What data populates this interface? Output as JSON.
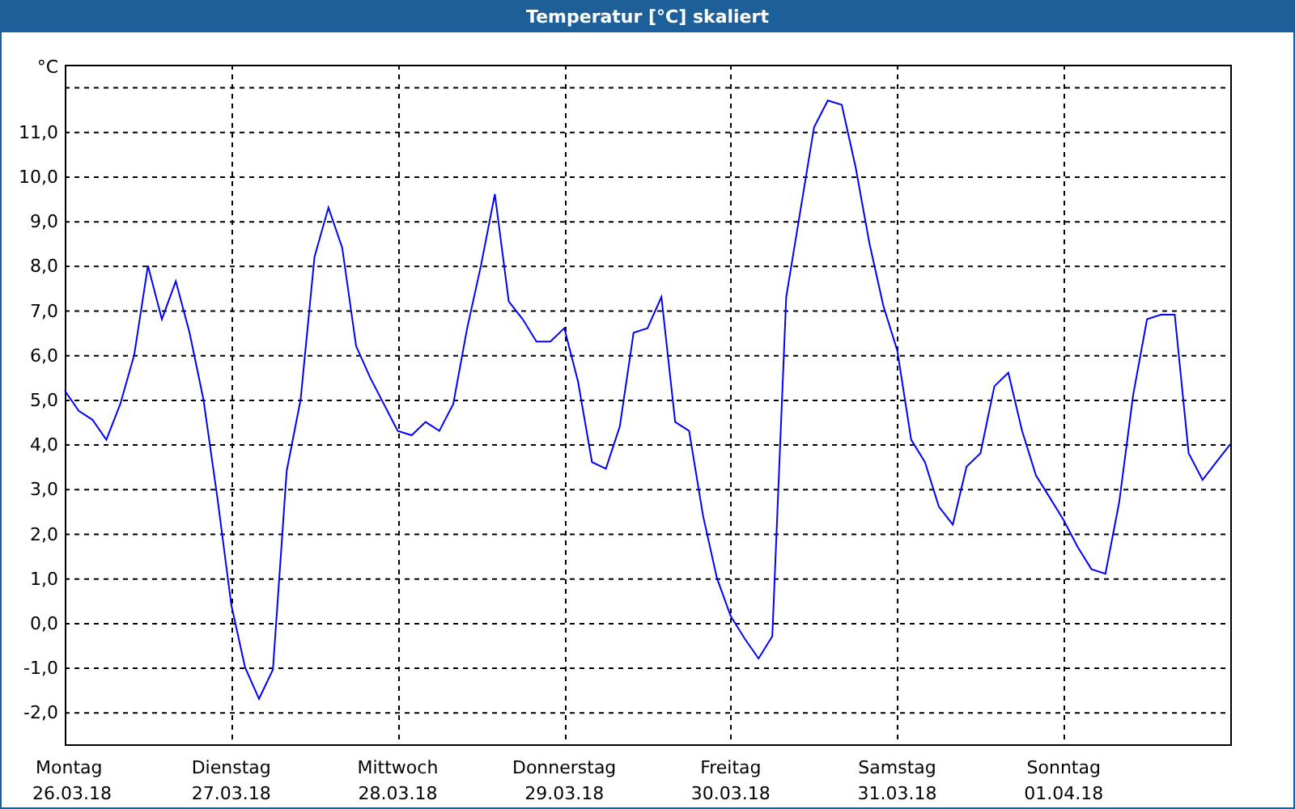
{
  "window": {
    "title": "Temperatur [°C] skaliert"
  },
  "chart": {
    "dates": [
      "26.03.18",
      "27.03.18",
      "28.03.18",
      "29.03.18",
      "30.03.18",
      "31.03.18",
      "01.04.18"
    ],
    "chart_data": {
      "type": "line",
      "grid": true,
      "ylabel": "°C",
      "ylim": [
        -2.72,
        12.5
      ],
      "yticks": [
        {
          "value": -2,
          "label": "-2,0"
        },
        {
          "value": -1,
          "label": "-1,0"
        },
        {
          "value": 0,
          "label": "0,0"
        },
        {
          "value": 1,
          "label": "1,0"
        },
        {
          "value": 2,
          "label": "2,0"
        },
        {
          "value": 3,
          "label": "3,0"
        },
        {
          "value": 4,
          "label": "4,0"
        },
        {
          "value": 5,
          "label": "5,0"
        },
        {
          "value": 6,
          "label": "6,0"
        },
        {
          "value": 7,
          "label": "7,0"
        },
        {
          "value": 8,
          "label": "8,0"
        },
        {
          "value": 9,
          "label": "9,0"
        },
        {
          "value": 10,
          "label": "10,0"
        },
        {
          "value": 11,
          "label": "11,0"
        }
      ],
      "categories": [
        "Montag",
        null,
        null,
        null,
        null,
        null,
        null,
        null,
        null,
        null,
        null,
        null,
        "Dienstag",
        null,
        null,
        null,
        null,
        null,
        null,
        null,
        null,
        null,
        null,
        null,
        "Mittwoch",
        null,
        null,
        null,
        null,
        null,
        null,
        null,
        null,
        null,
        null,
        null,
        "Donnerstag",
        null,
        null,
        null,
        null,
        null,
        null,
        null,
        null,
        null,
        null,
        null,
        "Freitag",
        null,
        null,
        null,
        null,
        null,
        null,
        null,
        null,
        null,
        null,
        null,
        "Samstag",
        null,
        null,
        null,
        null,
        null,
        null,
        null,
        null,
        null,
        null,
        null,
        "Sonntag",
        null,
        null,
        null,
        null,
        null,
        null,
        null,
        null,
        null,
        null,
        null,
        null
      ],
      "series": [
        {
          "color": "#0000ff",
          "values": [
            5.2,
            4.75,
            4.55,
            4.1,
            4.9,
            6.0,
            8.0,
            6.8,
            7.65,
            6.5,
            5.0,
            2.8,
            0.4,
            -1.0,
            -1.7,
            -1.05,
            3.4,
            5.0,
            8.2,
            9.3,
            8.4,
            6.2,
            5.5,
            4.9,
            4.3,
            4.2,
            4.5,
            4.3,
            4.9,
            6.6,
            8.0,
            9.6,
            7.2,
            6.8,
            6.3,
            6.3,
            6.6,
            5.4,
            3.6,
            3.45,
            4.4,
            6.5,
            6.6,
            7.3,
            4.5,
            4.3,
            2.4,
            1.0,
            0.15,
            -0.35,
            -0.8,
            -0.3,
            7.3,
            9.2,
            11.1,
            11.7,
            11.6,
            10.2,
            8.5,
            7.1,
            6.1,
            4.1,
            3.6,
            2.6,
            2.2,
            3.5,
            3.8,
            5.3,
            5.6,
            4.3,
            3.3,
            2.8,
            2.3,
            1.7,
            1.2,
            1.1,
            2.7,
            5.1,
            6.8,
            6.9,
            6.9,
            3.8,
            3.2,
            3.6,
            4.0
          ]
        }
      ]
    }
  }
}
